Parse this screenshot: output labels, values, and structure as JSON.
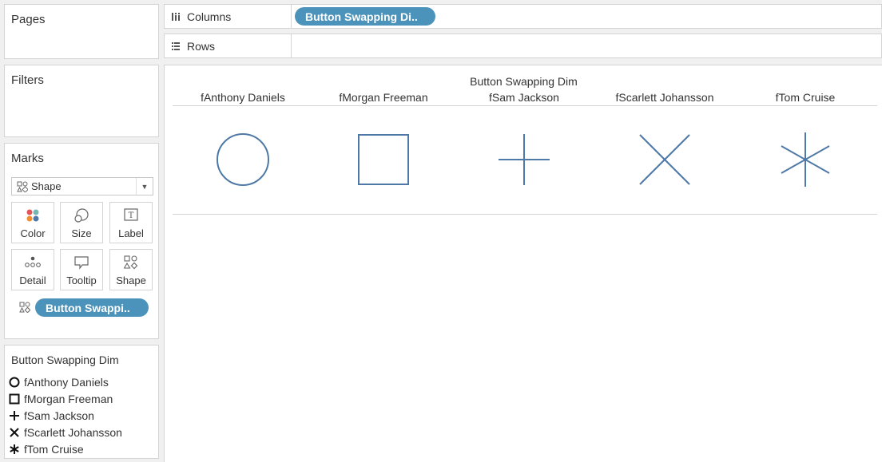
{
  "cards": {
    "pages_title": "Pages",
    "filters_title": "Filters",
    "marks_title": "Marks"
  },
  "marks": {
    "type_label": "Shape",
    "type_icon": "shapes-icon",
    "buttons": [
      {
        "label": "Color",
        "icon": "color-icon"
      },
      {
        "label": "Size",
        "icon": "size-icon"
      },
      {
        "label": "Label",
        "icon": "label-icon"
      },
      {
        "label": "Detail",
        "icon": "detail-icon"
      },
      {
        "label": "Tooltip",
        "icon": "tooltip-icon"
      },
      {
        "label": "Shape",
        "icon": "shape-icon"
      }
    ],
    "shape_pill": "Button Swappi..",
    "accent_color": "#4b93ba"
  },
  "legend": {
    "title": "Button Swapping Dim",
    "items": [
      {
        "label": "fAnthony Daniels",
        "shape": "circle"
      },
      {
        "label": "fMorgan Freeman",
        "shape": "square"
      },
      {
        "label": "fSam Jackson",
        "shape": "plus"
      },
      {
        "label": "fScarlett Johansson",
        "shape": "cross"
      },
      {
        "label": "fTom Cruise",
        "shape": "asterisk"
      }
    ]
  },
  "shelves": {
    "columns_label": "Columns",
    "columns_pill": "Button Swapping Di..",
    "rows_label": "Rows"
  },
  "view": {
    "header_title": "Button Swapping Dim",
    "columns": [
      "fAnthony Daniels",
      "fMorgan Freeman",
      "fSam Jackson",
      "fScarlett Johansson",
      "fTom Cruise"
    ],
    "shapes": [
      "circle",
      "square",
      "plus",
      "cross",
      "asterisk"
    ],
    "mark_color": "#4e79a7"
  }
}
